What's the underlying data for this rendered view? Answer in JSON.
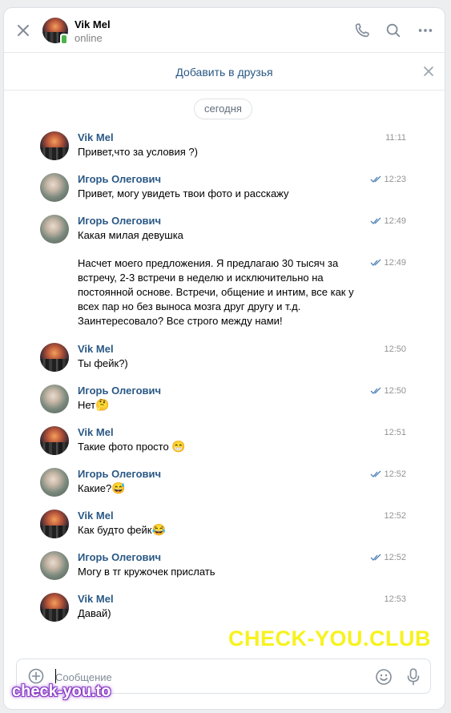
{
  "header": {
    "name": "Vik Mel",
    "status": "online"
  },
  "add_friend": {
    "label": "Добавить в друзья"
  },
  "date_separator": "сегодня",
  "messages": [
    {
      "author": "Vik Mel",
      "time": "11:11",
      "text": "Привет,что за условия ?)",
      "read": false,
      "emoji": ""
    },
    {
      "author": "Игорь Олегович",
      "time": "12:23",
      "text": "Привет, могу увидеть твои фото и расскажу",
      "read": true,
      "emoji": ""
    },
    {
      "author": "Игорь Олегович",
      "time": "12:49",
      "text": "Какая милая девушка",
      "read": true,
      "emoji": ""
    },
    {
      "author": "",
      "time": "12:49",
      "text": "Насчет моего предложения. Я предлагаю 30 тысяч за встречу, 2-3 встречи в неделю и исключительно на постоянной основе. Встречи, общение и интим, все как у всех пар но без выноса мозга друг другу и т.д. Заинтересовало? Все строго между нами!",
      "read": true,
      "emoji": ""
    },
    {
      "author": "Vik Mel",
      "time": "12:50",
      "text": "Ты фейк?)",
      "read": false,
      "emoji": ""
    },
    {
      "author": "Игорь Олегович",
      "time": "12:50",
      "text": "Нет",
      "read": true,
      "emoji": "🤔"
    },
    {
      "author": "Vik Mel",
      "time": "12:51",
      "text": "Такие фото просто ",
      "read": false,
      "emoji": "😁"
    },
    {
      "author": "Игорь Олегович",
      "time": "12:52",
      "text": "Какие?",
      "read": true,
      "emoji": "😅"
    },
    {
      "author": "Vik Mel",
      "time": "12:52",
      "text": "Как будто фейк",
      "read": false,
      "emoji": "😂"
    },
    {
      "author": "Игорь Олегович",
      "time": "12:52",
      "text": "Могу в тг кружочек прислать",
      "read": true,
      "emoji": ""
    },
    {
      "author": "Vik Mel",
      "time": "12:53",
      "text": "Давай)",
      "read": false,
      "emoji": ""
    }
  ],
  "composer": {
    "placeholder": "Сообщение"
  },
  "watermarks": {
    "big": "CHECK-YOU.CLUB",
    "small": "check-you.to"
  },
  "colors": {
    "link": "#2a5885",
    "accent": "#4a76a8",
    "online": "#4bb34b"
  }
}
